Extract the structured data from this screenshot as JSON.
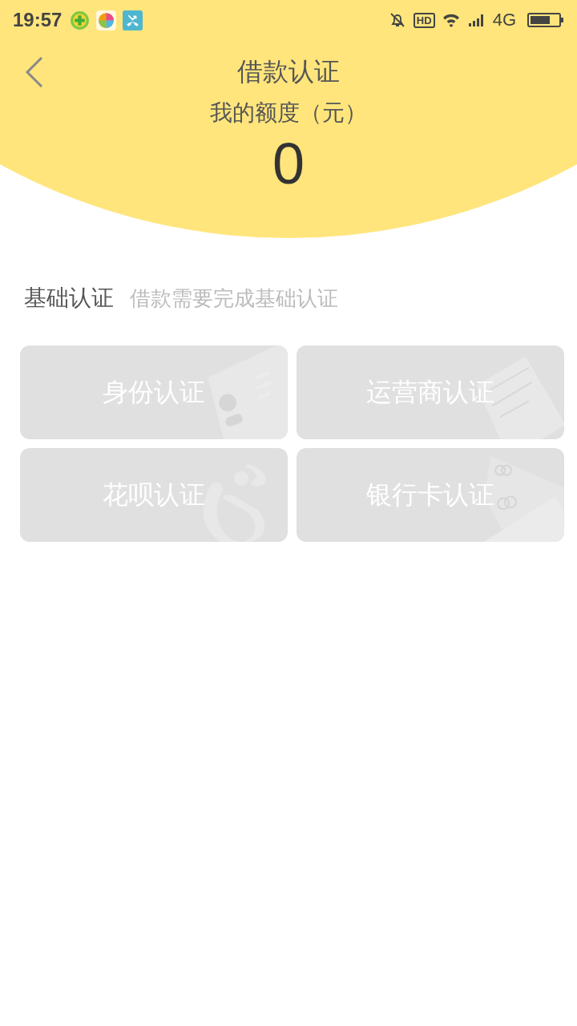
{
  "status_bar": {
    "time": "19:57",
    "hd": "HD",
    "network": "4G"
  },
  "header": {
    "title": "借款认证",
    "quota_label": "我的额度（元）",
    "quota": "0"
  },
  "section": {
    "title": "基础认证",
    "hint": "借款需要完成基础认证"
  },
  "cards": [
    {
      "label": "身份认证",
      "kind": "id",
      "disabled": true
    },
    {
      "label": "运营商认证",
      "kind": "phone",
      "disabled": true
    },
    {
      "label": "花呗认证",
      "kind": "huabei",
      "disabled": true
    },
    {
      "label": "银行卡认证",
      "kind": "bank",
      "disabled": true
    }
  ]
}
